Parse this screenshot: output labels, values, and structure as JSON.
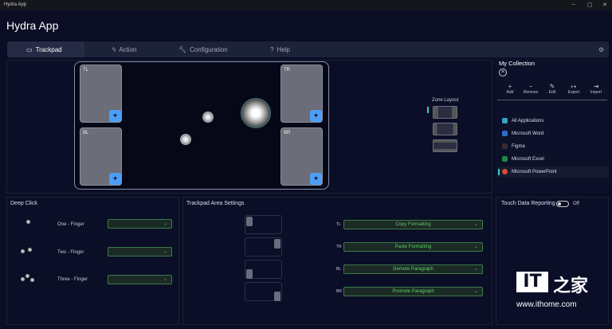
{
  "window": {
    "title": "Hydra App",
    "minimize": "–",
    "maximize": "▢",
    "close": "✕"
  },
  "app_title": "Hydra App",
  "tabs": [
    {
      "label": "Trackpad",
      "icon": "trackpad-icon"
    },
    {
      "label": "Action",
      "icon": "lightning-icon"
    },
    {
      "label": "Configuration",
      "icon": "wrench-icon"
    },
    {
      "label": "Help",
      "icon": "help-icon"
    }
  ],
  "trackpad": {
    "zones": [
      "TL",
      "TR",
      "BL",
      "BR"
    ]
  },
  "zone_layout": {
    "label": "Zone Layout",
    "selected": 0
  },
  "collection": {
    "title": "My Collection",
    "actions": [
      {
        "label": "Add",
        "glyph": "+"
      },
      {
        "label": "Remove",
        "glyph": "−"
      },
      {
        "label": "Edit",
        "glyph": "✎"
      },
      {
        "label": "Export",
        "glyph": "↦"
      },
      {
        "label": "Import",
        "glyph": "⇥"
      }
    ],
    "apps": [
      {
        "label": "All Applications",
        "color": "#3aa0c8"
      },
      {
        "label": "Microsoft Word",
        "color": "#2b6fd1"
      },
      {
        "label": "Figma",
        "color": "#3a2a2e"
      },
      {
        "label": "Microsoft Excel",
        "color": "#1d8a4a"
      },
      {
        "label": "Microsoft PowerPoint",
        "color": "#d3512f"
      }
    ],
    "selected_app": "Microsoft PowerPoint"
  },
  "deep_click": {
    "title": "Deep Click",
    "rows": [
      {
        "label": "One - Finger",
        "value": ""
      },
      {
        "label": "Two - Finger",
        "value": ""
      },
      {
        "label": "Three - Finger",
        "value": ""
      }
    ]
  },
  "area_settings": {
    "title": "Trackpad Area Settings",
    "rows": [
      {
        "zone": "TL",
        "value": "Copy Formatting"
      },
      {
        "zone": "TR",
        "value": "Paste Formatting"
      },
      {
        "zone": "BL",
        "value": "Demote Paragraph"
      },
      {
        "zone": "BR",
        "value": "Promote Paragraph"
      }
    ]
  },
  "touch_data": {
    "label": "Touch Data Reporting",
    "state": "Off"
  },
  "watermark": {
    "logo": "IT之家",
    "url": "www.ithome.com"
  }
}
